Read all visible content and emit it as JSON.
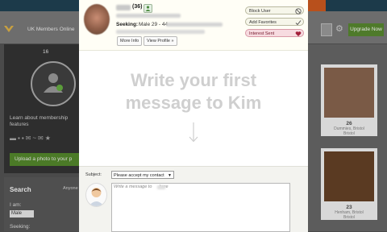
{
  "background": {
    "members_label": "UK Members Online",
    "upgrade_label": "Upgrade Now",
    "left_panel": {
      "count": "16",
      "learn_text": "Learn about membership features",
      "upload_label": "Upload a photo to your p"
    },
    "search": {
      "title": "Search",
      "anyone_label": "Anyone",
      "i_am_label": "I am:",
      "i_am_value": "Male",
      "seeking_label": "Seeking:"
    },
    "cards": [
      {
        "age": "26",
        "line1": "Dummies, Bristol",
        "line2": "Bristol"
      },
      {
        "age": "23",
        "line1": "Henham, Bristol",
        "line2": "Bristol"
      }
    ]
  },
  "profile": {
    "age": "(36)",
    "seeking_label": "Seeking:",
    "seeking_value": "Male 29 - 44",
    "more_info_label": "More Info",
    "view_profile_label": "View Profile »",
    "actions": {
      "block_label": "Block User",
      "favorites_label": "Add Favorites",
      "interest_label": "Interest Sent"
    }
  },
  "main": {
    "prompt_line1": "Write your first",
    "prompt_line2": "message to Kim"
  },
  "compose": {
    "subject_label": "Subject:",
    "subject_value": "Please accept my contact",
    "message_placeholder_start": "Write a message to",
    "message_placeholder_end": "here"
  },
  "colors": {
    "interest_bg": "#f7dbe0",
    "upgrade_green": "#4e7a2a",
    "header_bg": "#1c3a4a"
  }
}
